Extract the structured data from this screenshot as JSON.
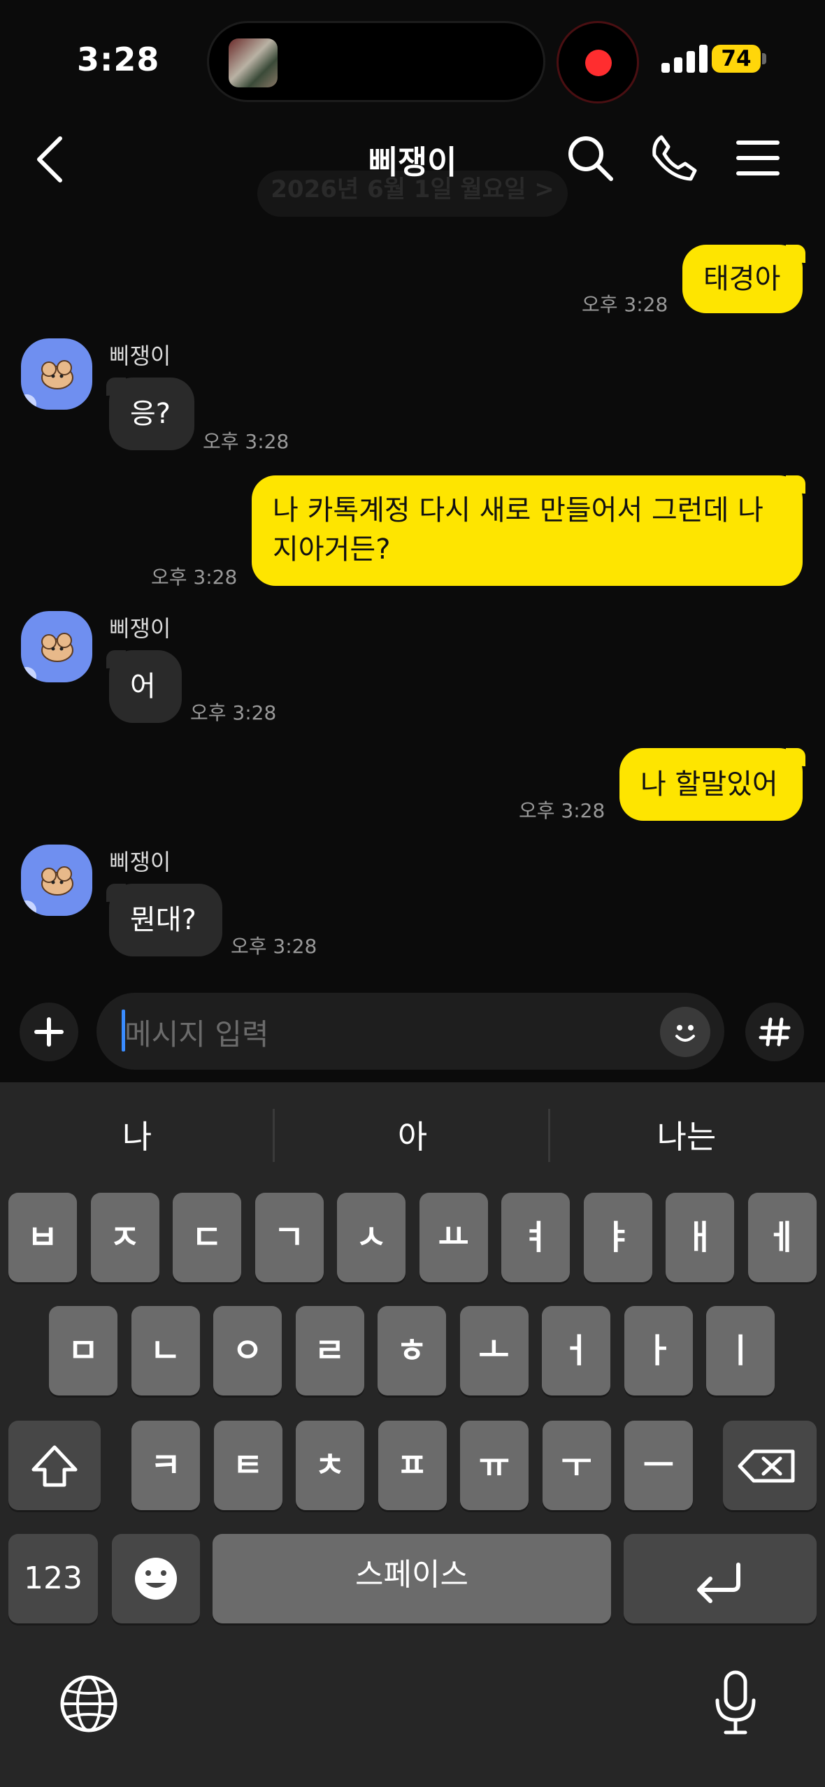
{
  "status_bar": {
    "time": "3:28",
    "battery": "74"
  },
  "header": {
    "title": "삐쟁이",
    "date_divider": "2026년 6월 1일 월요일 >"
  },
  "messages": [
    {
      "from": "me",
      "text": "태경아",
      "time": "오후 3:28"
    },
    {
      "from": "them",
      "sender": "삐쟁이",
      "text": "응?",
      "time": "오후 3:28"
    },
    {
      "from": "me",
      "text_line1": "나 카톡계정 다시 새로 만들어서 그런데 나",
      "text_line2": "지아거든?",
      "time": "오후 3:28"
    },
    {
      "from": "them",
      "sender": "삐쟁이",
      "text": "어",
      "time": "오후 3:28"
    },
    {
      "from": "me",
      "text": "나 할말있어",
      "time": "오후 3:28"
    },
    {
      "from": "them",
      "sender": "삐쟁이",
      "text": "뭔대?",
      "time": "오후 3:28"
    }
  ],
  "input": {
    "placeholder": "메시지 입력"
  },
  "keyboard": {
    "suggestions": [
      "나",
      "아",
      "나는"
    ],
    "row1": [
      "ㅂ",
      "ㅈ",
      "ㄷ",
      "ㄱ",
      "ㅅ",
      "ㅛ",
      "ㅕ",
      "ㅑ",
      "ㅐ",
      "ㅔ"
    ],
    "row2": [
      "ㅁ",
      "ㄴ",
      "ㅇ",
      "ㄹ",
      "ㅎ",
      "ㅗ",
      "ㅓ",
      "ㅏ",
      "ㅣ"
    ],
    "row3": [
      "ㅋ",
      "ㅌ",
      "ㅊ",
      "ㅍ",
      "ㅠ",
      "ㅜ",
      "ㅡ"
    ],
    "numbers_key": "123",
    "space_key": "스페이스"
  },
  "colors": {
    "my_bubble": "#fee500",
    "their_bubble": "#2a2a2a",
    "avatar": "#6f8ff0",
    "recording": "#ff2d2f"
  },
  "icons": [
    "back-icon",
    "search-icon",
    "phone-icon",
    "menu-icon",
    "plus-icon",
    "emoji-icon",
    "hashtag-icon",
    "shift-icon",
    "backspace-icon",
    "return-icon",
    "globe-icon",
    "microphone-icon"
  ]
}
